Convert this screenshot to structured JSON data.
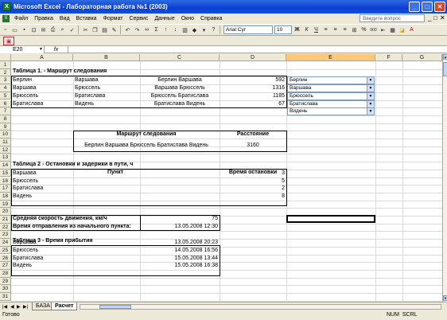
{
  "window": {
    "title": "Microsoft Excel - Лабораторная работа №1 (2003)",
    "min": "_",
    "max": "□",
    "close": "✕"
  },
  "menu": {
    "items": [
      "Файл",
      "Правка",
      "Вид",
      "Вставка",
      "Формат",
      "Сервис",
      "Данные",
      "Окно",
      "Справка"
    ],
    "help_placeholder": "Введите вопрос",
    "mdi": [
      "_",
      "□",
      "✕"
    ]
  },
  "toolbar": {
    "font_name": "Arial Cyr",
    "font_size": "10",
    "sigma": "Σ",
    "bold": "Ж",
    "italic": "К",
    "underline": "Ч",
    "percent": "%",
    "thousands": "000"
  },
  "formula": {
    "name_box": "E20",
    "fx": "fx",
    "value": ""
  },
  "columns": [
    "A",
    "B",
    "C",
    "D",
    "E",
    "F",
    "G"
  ],
  "selected_column": "E",
  "rows": [
    "1",
    "2",
    "3",
    "4",
    "5",
    "6",
    "7",
    "8",
    "9",
    "10",
    "11",
    "12",
    "13",
    "14",
    "15",
    "16",
    "17",
    "18",
    "19",
    "20",
    "21",
    "22",
    "23",
    "24",
    "25",
    "26",
    "27",
    "28",
    "29",
    "30",
    "31"
  ],
  "table1": {
    "title": "Таблица 1. - Маршрут следования",
    "rows": [
      {
        "a": "Берлин",
        "b": "Варшава",
        "c": "Берлин Варшава",
        "d": "592"
      },
      {
        "a": "Варшава",
        "b": "Брюссель",
        "c": "Варшава Брюссель",
        "d": "1316"
      },
      {
        "a": "Брюссель",
        "b": "Братислава",
        "c": "Брюссель Братислава",
        "d": "1185"
      },
      {
        "a": "Братислава",
        "b": "Видень",
        "c": "Братислава Видень",
        "d": "67"
      }
    ],
    "dropdowns": [
      "Берлин",
      "Варшава",
      "Брюссель",
      "Братислава",
      "Видень"
    ]
  },
  "route": {
    "hdr_route": "Маршрут следования",
    "hdr_dist": "Расстояние",
    "route": "Берлин Варшава Брюссель Братислава Видень",
    "dist": "3160"
  },
  "table2": {
    "title": "Таблица 2 - Остановки и задержки в пути, ч",
    "hdr_point": "Пункт",
    "hdr_stop": "Время остановки",
    "rows": [
      {
        "p": "Варшава",
        "t": "3"
      },
      {
        "p": "Брюссель",
        "t": "5"
      },
      {
        "p": "Братислава",
        "t": "2"
      },
      {
        "p": "Видень",
        "t": "8"
      }
    ]
  },
  "speed": {
    "label": "Средняя скорость движения, км/ч",
    "value": "75"
  },
  "depart": {
    "label": "Время отправления из начального пункта:",
    "value": "13.05.2008 12:30"
  },
  "table3": {
    "title": "Таблица 3 - Время прибытия",
    "rows": [
      {
        "p": "Варшава",
        "t": "13.05.2008 20:23"
      },
      {
        "p": "Брюссель",
        "t": "14.05.2008 16:56"
      },
      {
        "p": "Братислава",
        "t": "15.05.2008 13:44"
      },
      {
        "p": "Видень",
        "t": "15.05.2008 16:38"
      }
    ]
  },
  "sheets": [
    "БАЗА",
    "Расчет"
  ],
  "active_sheet": "Расчет",
  "status": {
    "left": "Готово",
    "right": "NUM  SCRL"
  }
}
